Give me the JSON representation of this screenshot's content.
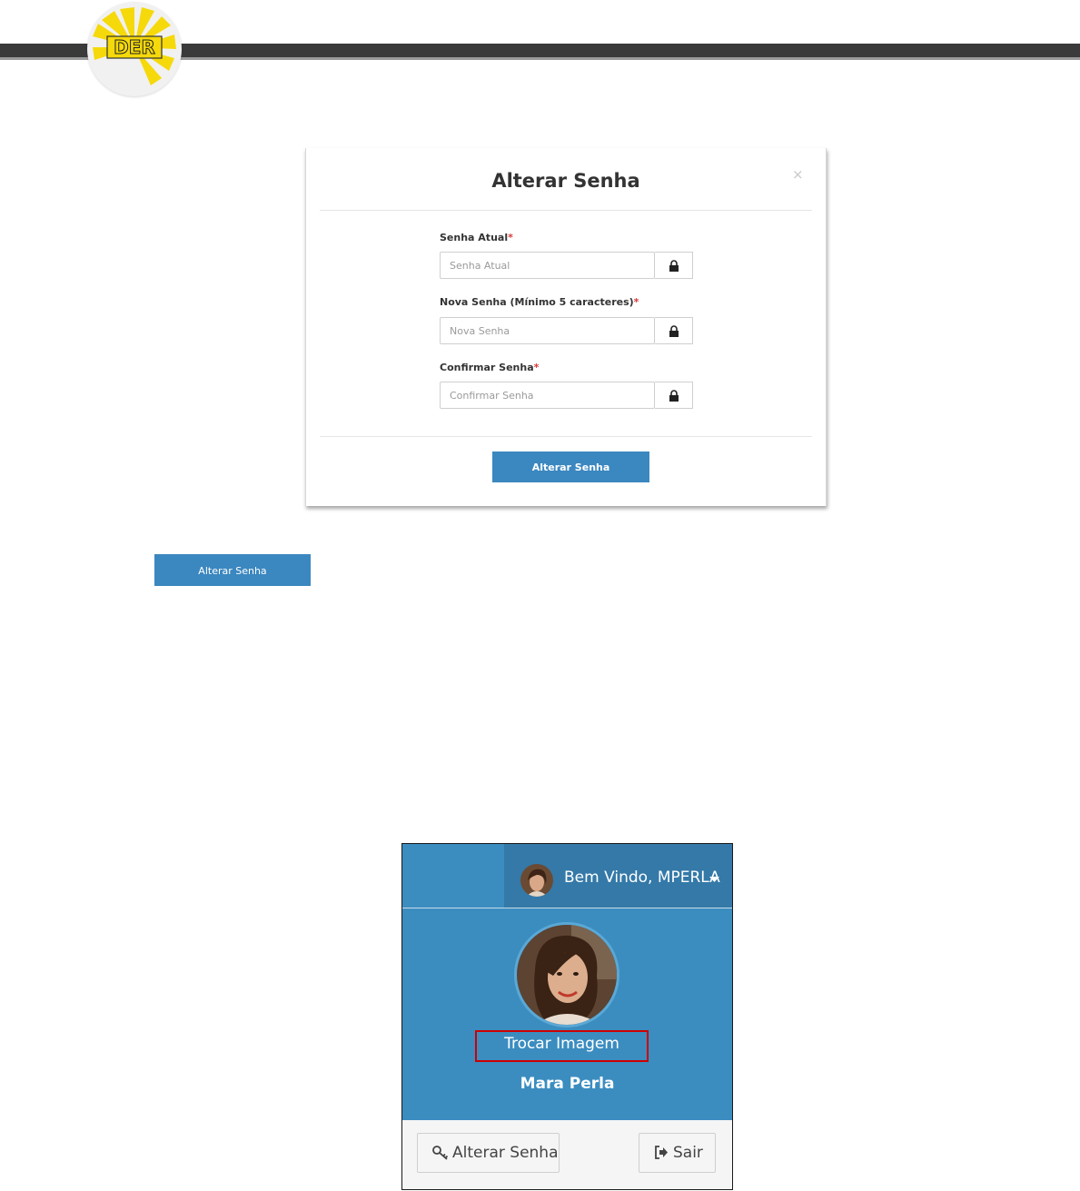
{
  "logo": {
    "text": "DER",
    "colors": {
      "yellow": "#f5d90a",
      "grey": "#3a3a3a"
    }
  },
  "modal": {
    "title": "Alterar Senha",
    "close_glyph": "×",
    "fields": [
      {
        "label": "Senha Atual",
        "required": "*",
        "placeholder": "Senha Atual",
        "icon": "lock-icon"
      },
      {
        "label": "Nova Senha (Mínimo 5 caracteres)",
        "required": "*",
        "placeholder": "Nova Senha",
        "icon": "lock-icon"
      },
      {
        "label": "Confirmar Senha",
        "required": "*",
        "placeholder": "Confirmar Senha",
        "icon": "lock-icon"
      }
    ],
    "submit_label": "Alterar Senha"
  },
  "standalone_button": {
    "label": "Alterar Senha"
  },
  "user_panel": {
    "welcome": "Bem Vindo, MPERLA",
    "change_image": "Trocar Imagem",
    "name": "Mara Perla",
    "change_password_label": "Alterar Senha",
    "logout_label": "Sair",
    "colors": {
      "panel": "#3b8dc0",
      "highlight": "#cc0000"
    }
  }
}
